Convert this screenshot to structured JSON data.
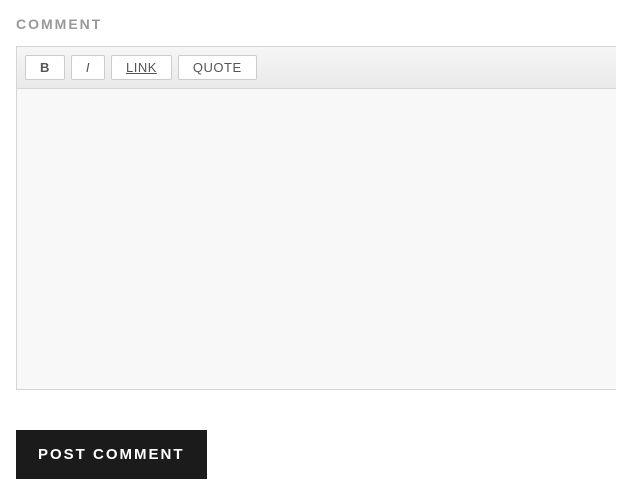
{
  "form": {
    "label": "Comment",
    "toolbar": {
      "bold": "B",
      "italic": "I",
      "link": "LINK",
      "quote": "QUOTE"
    },
    "textarea_value": "",
    "submit_label": "Post Comment"
  }
}
